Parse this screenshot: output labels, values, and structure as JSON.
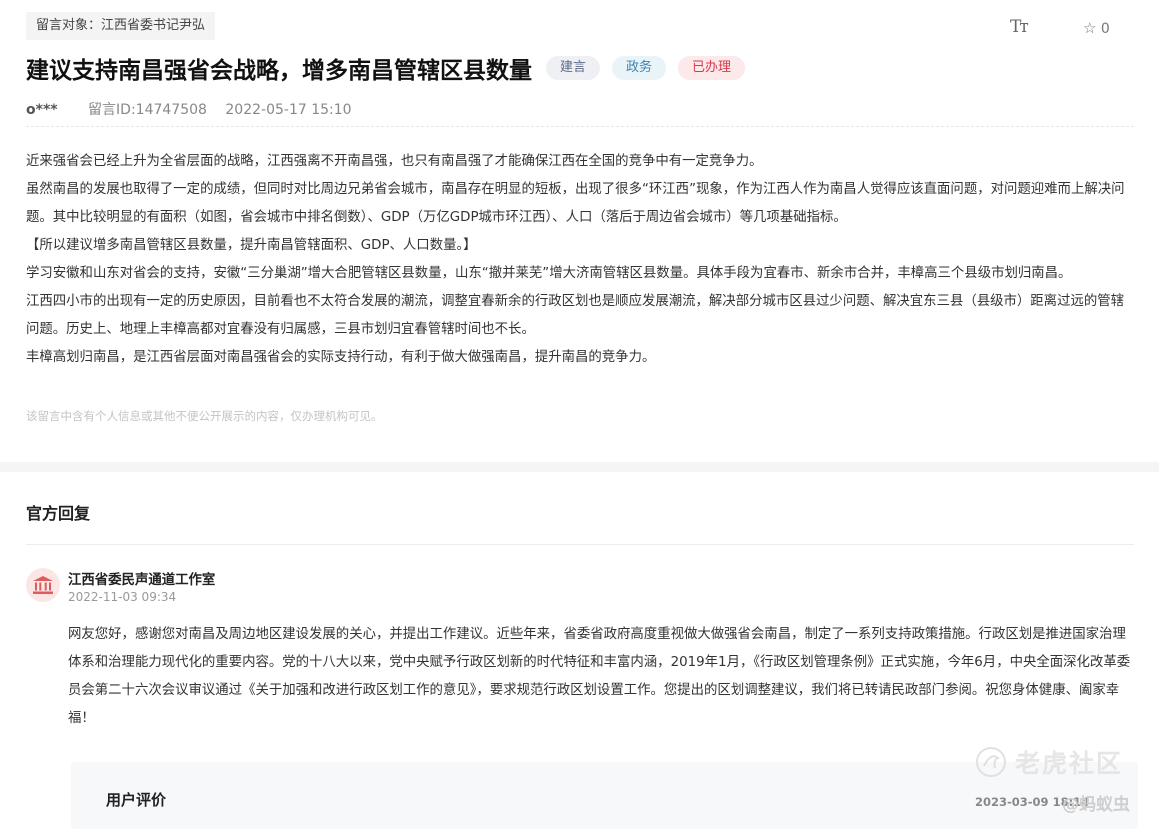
{
  "header": {
    "target_chip": "留言对象：江西省委书记尹弘",
    "font_size_toggle": "Tт",
    "favorite_count": "0"
  },
  "message": {
    "title": "建议支持南昌强省会战略，增多南昌管辖区县数量",
    "tags": [
      "建言",
      "政务",
      "已办理"
    ],
    "author": "o***",
    "message_id": "留言ID:14747508",
    "datetime": "2022-05-17 15:10",
    "paragraphs": [
      "近来强省会已经上升为全省层面的战略，江西强离不开南昌强，也只有南昌强了才能确保江西在全国的竞争中有一定竞争力。",
      "虽然南昌的发展也取得了一定的成绩，但同时对比周边兄弟省会城市，南昌存在明显的短板，出现了很多“环江西”现象，作为江西人作为南昌人觉得应该直面问题，对问题迎难而上解决问题。其中比较明显的有面积（如图，省会城市中排名倒数）、GDP（万亿GDP城市环江西）、人口（落后于周边省会城市）等几项基础指标。",
      "【所以建议增多南昌管辖区县数量，提升南昌管辖面积、GDP、人口数量。】",
      "学习安徽和山东对省会的支持，安徽“三分巢湖”增大合肥管辖区县数量，山东“撤并莱芜”增大济南管辖区县数量。具体手段为宜春市、新余市合并，丰樟高三个县级市划归南昌。",
      "江西四小市的出现有一定的历史原因，目前看也不太符合发展的潮流，调整宜春新余的行政区划也是顺应发展潮流，解决部分城市区县过少问题、解决宜东三县（县级市）距离过远的管辖问题。历史上、地理上丰樟高都对宜春没有归属感，三县市划归宜春管辖时间也不长。",
      "丰樟高划归南昌，是江西省层面对南昌强省会的实际支持行动，有利于做大做强南昌，提升南昌的竞争力。"
    ],
    "privacy_hint": "该留言中含有个人信息或其他不便公开展示的内容，仅办理机构可见。"
  },
  "reply": {
    "heading": "官方回复",
    "department": "江西省委民声通道工作室",
    "datetime": "2022-11-03 09:34",
    "text": "网友您好，感谢您对南昌及周边地区建设发展的关心，并提出工作建议。近些年来，省委省政府高度重视做大做强省会南昌，制定了一系列支持政策措施。行政区划是推进国家治理体系和治理能力现代化的重要内容。党的十八大以来，党中央赋予行政区划新的时代特征和丰富内涵，2019年1月，《行政区划管理条例》正式实施，今年6月，中央全面深化改革委员会第二十六次会议审议通过《关于加强和改进行政区划工作的意见》，要求规范行政区划设置工作。您提出的区划调整建议，我们将已转请民政部门参阅。祝您身体健康、阖家幸福！"
  },
  "evaluation": {
    "label": "用户评价",
    "datetime": "2023-03-09 18:14"
  },
  "watermark": {
    "title": "老虎社区",
    "sub": "@蚂蚁虫"
  },
  "colors": {
    "tag_advice": "#5b6b8c",
    "tag_gov": "#3a84b4",
    "tag_done": "#d8394d",
    "avatar_icon": "#e05b5b"
  }
}
